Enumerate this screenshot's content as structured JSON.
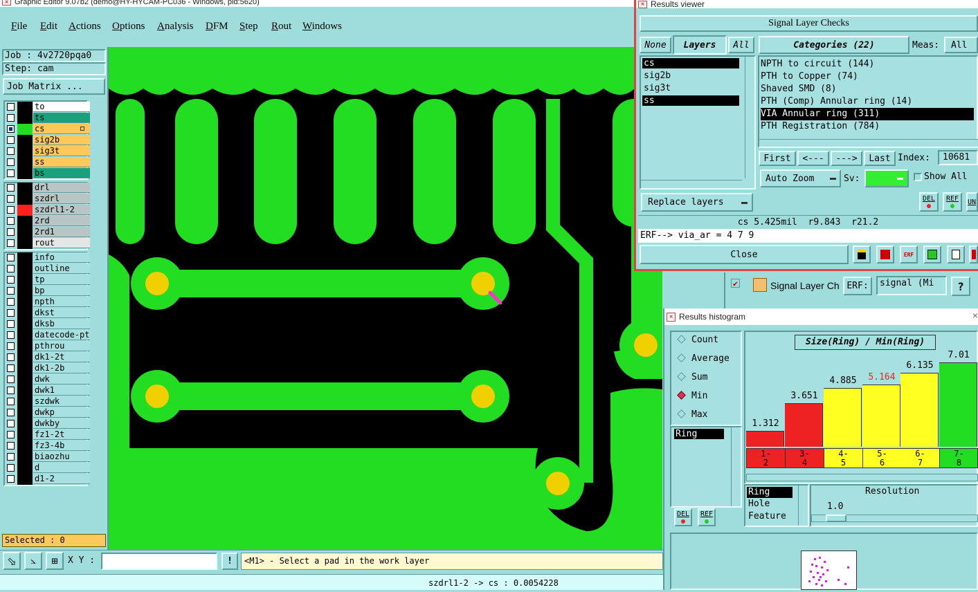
{
  "main_window": {
    "title": "Graphic Editor 9.07b2 (demo@HY-HYCAM-PC036 - Windows, pid:5620)",
    "menu": [
      "File",
      "Edit",
      "Actions",
      "Options",
      "Analysis",
      "DFM",
      "Step",
      "Rout",
      "Windows"
    ],
    "job_label": "Job : 4v2720pqa0",
    "step_label": "Step: cam",
    "job_matrix_button": "Job Matrix ...",
    "layers_board": [
      {
        "name": "to",
        "color": "#ffffff",
        "swatch": "#000000"
      },
      {
        "name": "ts",
        "color": "#1aa07a",
        "swatch": "#000000"
      },
      {
        "name": "cs",
        "color": "#ffc85a",
        "swatch": "#22dd22",
        "active": true
      },
      {
        "name": "sig2b",
        "color": "#ffc85a",
        "swatch": "#000000"
      },
      {
        "name": "sig3t",
        "color": "#ffc85a",
        "swatch": "#000000"
      },
      {
        "name": "ss",
        "color": "#ffc85a",
        "swatch": "#000000"
      },
      {
        "name": "bs",
        "color": "#1aa07a",
        "swatch": "#000000"
      }
    ],
    "layers_drill": [
      {
        "name": "drl",
        "color": "#b9c4c4",
        "swatch": "#000000"
      },
      {
        "name": "szdrl",
        "color": "#b9c4c4",
        "swatch": "#000000"
      },
      {
        "name": "szdrl1-2",
        "color": "#b9c4c4",
        "swatch": "#ff2020"
      },
      {
        "name": "2rd",
        "color": "#b9c4c4",
        "swatch": "#000000"
      },
      {
        "name": "2rd1",
        "color": "#b9c4c4",
        "swatch": "#000000"
      },
      {
        "name": "rout",
        "color": "#e6e6e6",
        "swatch": "#000000"
      }
    ],
    "layers_misc": [
      "info",
      "outline",
      "tp",
      "bp",
      "npth",
      "dkst",
      "dksb",
      "datecode-pte",
      "pthrou",
      "dk1-2t",
      "dk1-2b",
      "dwk",
      "dwk1",
      "szdwk",
      "dwkp",
      "dwkby",
      "fz1-2t",
      "fz3-4b",
      "biaozhu",
      "d",
      "d1-2"
    ],
    "selected_label": "Selected : 0",
    "xy_label": "X Y :",
    "xy_value": "",
    "prompt": "<M1> - Select a pad in the work layer",
    "status_line": "szdrl1-2 -> cs : 0.0054228"
  },
  "results_viewer": {
    "title": "Results viewer",
    "header": "Signal Layer Checks",
    "btn_none": "None",
    "btn_layers": "Layers",
    "btn_all": "All",
    "categories_button": "Categories (22)",
    "meas_label": "Meas:",
    "meas_value": "All",
    "layers": [
      "cs",
      "sig2b",
      "sig3t",
      "ss"
    ],
    "categories": [
      "NPTH to circuit (144)",
      "PTH to Copper (74)",
      "Shaved SMD (8)",
      "PTH (Comp) Annular ring (14)",
      "VIA Annular ring (311)",
      "PTH Registration (784)"
    ],
    "first": "First",
    "prev": "<---",
    "next": "--->",
    "last": "Last",
    "index_label": "Index:",
    "index_value": "10681",
    "auto_zoom": "Auto Zoom",
    "sv_label": "Sv:",
    "show_all": "Show All",
    "replace_layers": "Replace layers",
    "del": "DEL",
    "ref": "REF",
    "un": "UN",
    "measure": "cs 5.425mil  r9.843  r21.2",
    "erf_line": "ERF--> via_ar = 4 7 9",
    "close": "Close"
  },
  "signal_layer_panel": {
    "title": "Signal Layer Ch",
    "erf_label": "ERF:",
    "erf_value": "signal (Mi",
    "help": "?"
  },
  "histogram": {
    "title": "Results histogram",
    "modes": [
      "Count",
      "Average",
      "Sum",
      "Min",
      "Max"
    ],
    "selected_mode": "Min",
    "list": [
      "Ring"
    ],
    "list2": [
      "Ring",
      "Hole",
      "Feature"
    ],
    "resolution_label": "Resolution",
    "resolution_value": "1.0",
    "chart_title": "Size(Ring) / Min(Ring)",
    "del": "DEL",
    "ref": "REF"
  },
  "chart_data": {
    "type": "bar",
    "title": "Size(Ring) / Min(Ring)",
    "categories": [
      "1-2",
      "3-4",
      "4-5",
      "5-6",
      "6-7",
      "7-8"
    ],
    "values": [
      1.312,
      3.651,
      4.885,
      5.164,
      6.135,
      7.01
    ],
    "value_labels": [
      "1.312",
      "3.651",
      "4.885",
      "5.164",
      "6.135",
      "7.01"
    ],
    "colors": [
      "#ee2222",
      "#ee2222",
      "#ffff22",
      "#ffff22",
      "#ffff22",
      "#22dd22"
    ],
    "label_colors": [
      "#000000",
      "#000000",
      "#000000",
      "#ee2222",
      "#000000",
      "#000000"
    ],
    "ylim": [
      0,
      7.6
    ]
  }
}
